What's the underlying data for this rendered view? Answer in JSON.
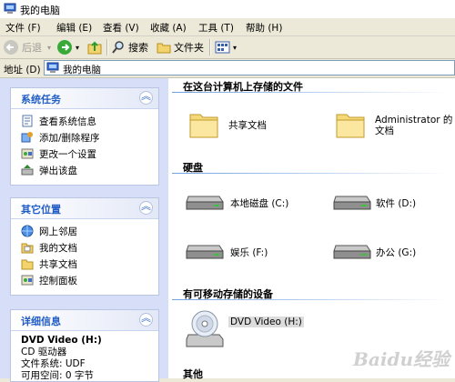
{
  "window": {
    "title": "我的电脑"
  },
  "menu": [
    "文件 (F)",
    "编辑 (E)",
    "查看 (V)",
    "收藏 (A)",
    "工具 (T)",
    "帮助 (H)"
  ],
  "toolbar": {
    "back": "后退",
    "search": "搜索",
    "folders": "文件夹"
  },
  "address": {
    "label": "地址 (D)",
    "value": "我的电脑"
  },
  "panels": {
    "system_tasks": {
      "title": "系统任务",
      "items": [
        "查看系统信息",
        "添加/删除程序",
        "更改一个设置",
        "弹出该盘"
      ]
    },
    "other_places": {
      "title": "其它位置",
      "items": [
        "网上邻居",
        "我的文档",
        "共享文档",
        "控制面板"
      ]
    },
    "details": {
      "title": "详细信息",
      "name": "DVD Video (H:)",
      "type": "CD 驱动器",
      "fs_label": "文件系统: UDF",
      "free_label": "可用空间: 0 字节"
    }
  },
  "sections": {
    "stored_files": {
      "title": "在这台计算机上存储的文件",
      "items": [
        "共享文档",
        "Administrator 的文档"
      ]
    },
    "hard_disks": {
      "title": "硬盘",
      "items": [
        "本地磁盘 (C:)",
        "软件 (D:)",
        "娱乐 (F:)",
        "办公 (G:)"
      ]
    },
    "removable": {
      "title": "有可移动存储的设备",
      "items": [
        "DVD Video (H:)"
      ]
    },
    "other": {
      "title": "其他"
    }
  },
  "watermark": "Baidu经验",
  "colors": {
    "left_pane_bg": "#d6dff7",
    "panel_head_text": "#215dc6",
    "selection": "#316ac5"
  }
}
